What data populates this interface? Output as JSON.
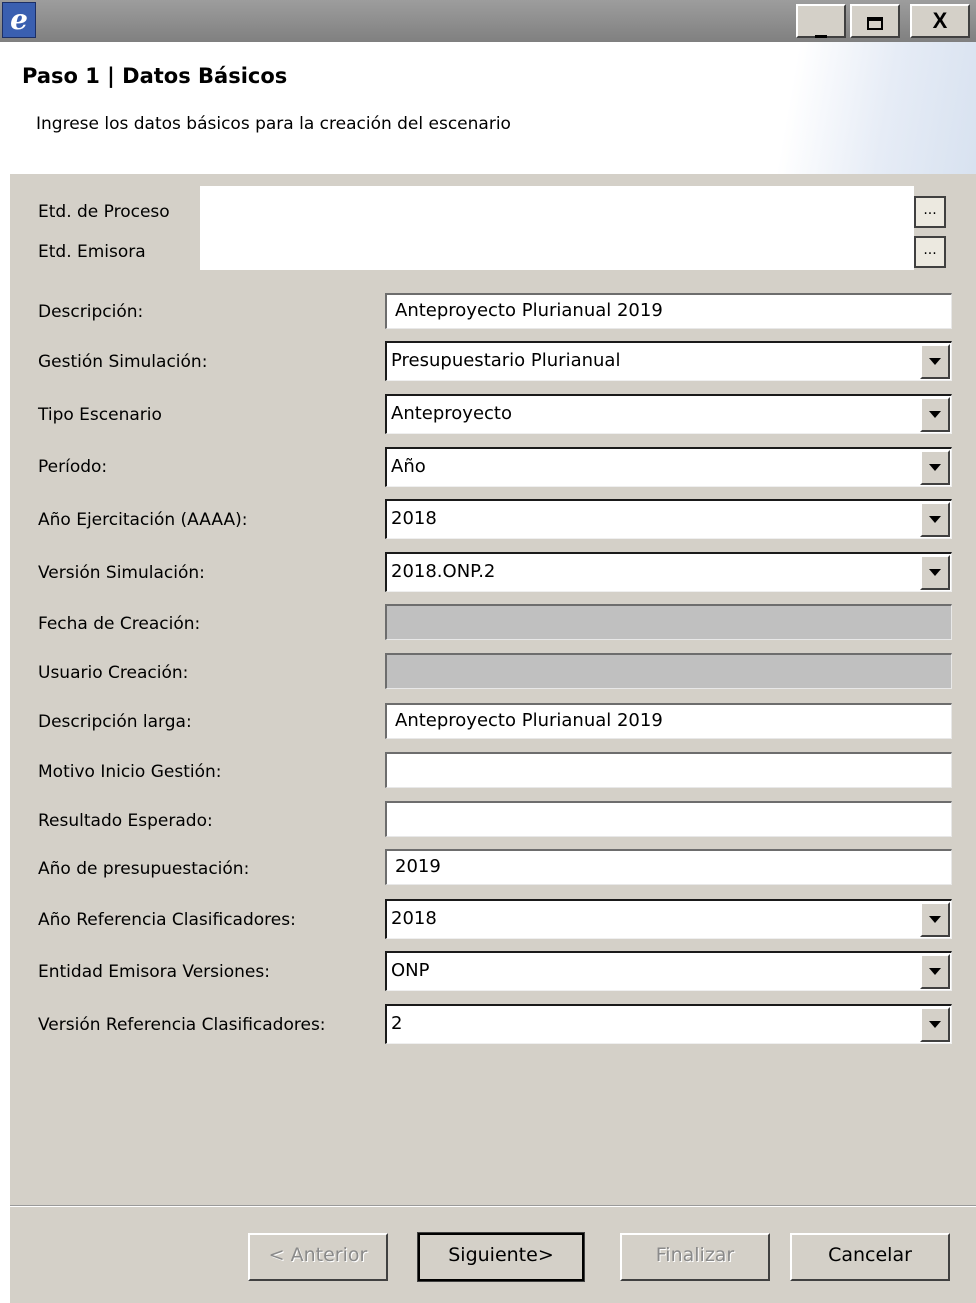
{
  "window": {
    "app_icon_glyph": "e",
    "minimize_glyph": "_",
    "close_glyph": "X"
  },
  "header": {
    "title": "Paso 1 | Datos Básicos",
    "subtitle": "Ingrese los datos básicos para la creación del escenario"
  },
  "entity": {
    "proceso_label": "Etd. de Proceso",
    "emisora_label": "Etd. Emisora",
    "browse_label": "..."
  },
  "form": {
    "descripcion": {
      "label": "Descripción:",
      "value": "Anteproyecto Plurianual 2019"
    },
    "gestion_simulacion": {
      "label": "Gestión Simulación:",
      "value": "Presupuestario Plurianual"
    },
    "tipo_escenario": {
      "label": "Tipo Escenario",
      "value": "Anteproyecto"
    },
    "periodo": {
      "label": "Período:",
      "value": "Año"
    },
    "anio_ejercitacion": {
      "label": "Año Ejercitación (AAAA):",
      "value": "2018"
    },
    "version_simulacion": {
      "label": "Versión Simulación:",
      "value": "2018.ONP.2"
    },
    "fecha_creacion": {
      "label": "Fecha de Creación:",
      "value": ""
    },
    "usuario_creacion": {
      "label": "Usuario Creación:",
      "value": ""
    },
    "descripcion_larga": {
      "label": "Descripción larga:",
      "value": "Anteproyecto Plurianual 2019"
    },
    "motivo_inicio": {
      "label": "Motivo Inicio Gestión:",
      "value": ""
    },
    "resultado_esperado": {
      "label": "Resultado Esperado:",
      "value": ""
    },
    "anio_presupuestacion": {
      "label": "Año de presupuestación:",
      "value": "2019"
    },
    "anio_ref_clasificadores": {
      "label": "Año Referencia Clasificadores:",
      "value": "2018"
    },
    "entidad_emisora_versiones": {
      "label": "Entidad Emisora Versiones:",
      "value": "ONP"
    },
    "version_ref_clasificadores": {
      "label": "Versión Referencia Clasificadores:",
      "value": "2"
    }
  },
  "buttons": {
    "anterior": "< Anterior",
    "siguiente": "Siguiente>",
    "finalizar": "Finalizar",
    "cancelar": "Cancelar"
  }
}
